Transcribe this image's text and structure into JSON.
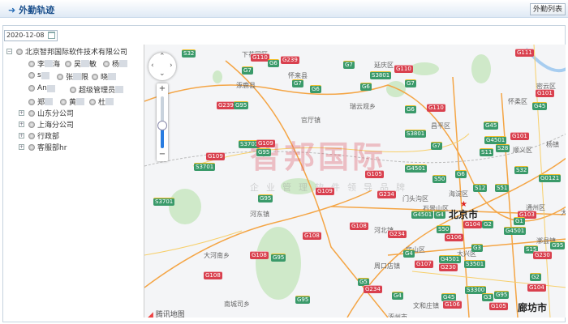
{
  "header": {
    "title": "外勤轨迹",
    "arrow_icon": "arrow-right-icon",
    "list_button": "外勤列表"
  },
  "date": {
    "value": "2020-12-08",
    "icon": "calendar-icon"
  },
  "tree": {
    "root": "北京智邦国际软件技术有限公司",
    "users": [
      [
        "李",
        "海"
      ],
      [
        "吴",
        "敏"
      ],
      [
        "杨",
        ""
      ],
      [
        "s",
        ""
      ],
      [
        "张",
        "限"
      ],
      [
        "晓",
        ""
      ],
      [
        "An",
        ""
      ],
      [
        "超级管理员",
        ""
      ],
      [
        "郑",
        ""
      ],
      [
        "黄",
        ""
      ],
      [
        "杜",
        ""
      ]
    ],
    "branches": [
      "山东分公司",
      "上海分公司",
      "行政部",
      "客服部hr"
    ]
  },
  "map": {
    "watermark": "智邦国际",
    "watermark_sub": "企业管理软件领导品牌",
    "provider": "腾讯地图",
    "zoom_level_fraction": 0.45,
    "places": [
      "下花园区",
      "怀来县",
      "涿鹿县",
      "瑞云观乡",
      "官厅镇",
      "延庆区",
      "昌平区",
      "怀柔区",
      "密云区",
      "顺义区",
      "杨镇",
      "门头沟区",
      "海淀区",
      "石景山区",
      "北京市",
      "通州区",
      "河东镇",
      "河北镇",
      "大河南乡",
      "房山区",
      "大兴区",
      "漷县镇",
      "周口店镇",
      "南城司乡",
      "文和庄镇",
      "涿州市",
      "廊坊市",
      "大厂"
    ],
    "shields": [
      "S32",
      "G110",
      "G6",
      "G239",
      "G7",
      "G7",
      "G6",
      "G7",
      "G239",
      "G95",
      "S3701",
      "G109",
      "G95",
      "G109",
      "S3701",
      "G111",
      "G110",
      "S3801",
      "G6",
      "G7",
      "G6",
      "G110",
      "G45",
      "G101",
      "G45",
      "S3801",
      "G4501",
      "G7",
      "S11",
      "S28",
      "G101",
      "S32",
      "G0121",
      "G4501",
      "G6",
      "S50",
      "G105",
      "G109",
      "G234",
      "G95",
      "S3701",
      "G4501",
      "G4",
      "G104",
      "G2",
      "G108",
      "G234",
      "S50",
      "G103",
      "G1",
      "G4501",
      "G106",
      "G108",
      "G3",
      "G4",
      "G95",
      "S15",
      "G230",
      "G108",
      "G95",
      "G4501",
      "G107",
      "G230",
      "S3501",
      "G108",
      "G2",
      "G5",
      "G234",
      "S3300",
      "G104",
      "G4",
      "G45",
      "G3",
      "G95",
      "G106",
      "G105",
      "G95",
      "S12",
      "S51"
    ]
  }
}
